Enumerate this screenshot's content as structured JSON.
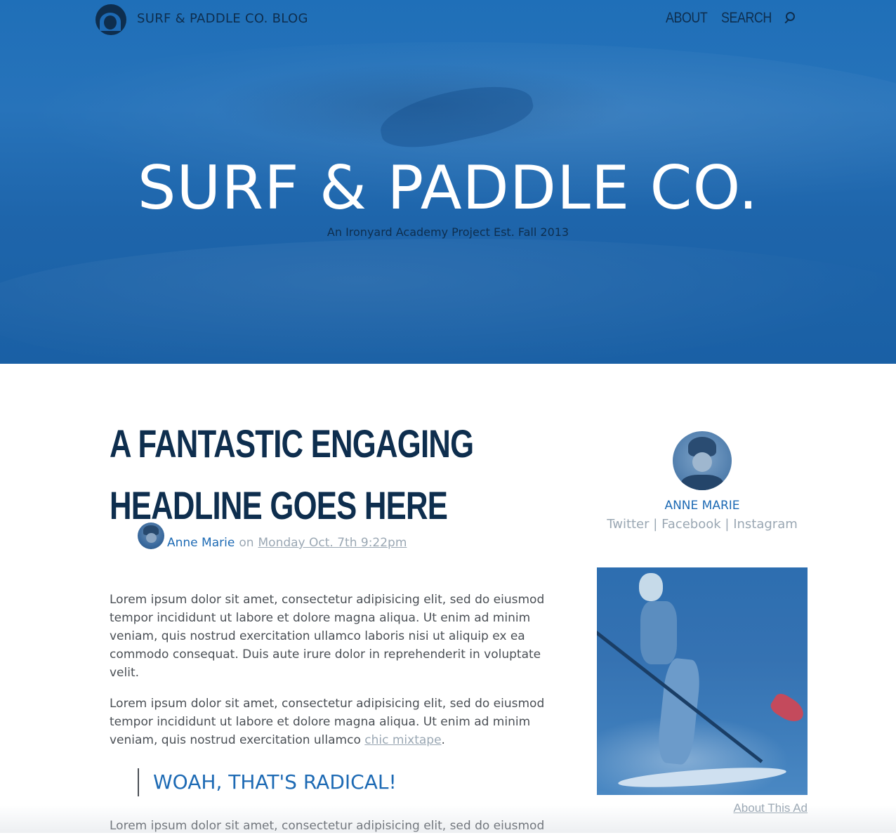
{
  "header": {
    "brand": "SURF & PADDLE CO. BLOG",
    "nav": {
      "about": "ABOUT",
      "search": "SEARCH"
    }
  },
  "hero": {
    "title": "SURF & PADDLE CO.",
    "subtitle": "An Ironyard Academy Project Est. Fall 2013"
  },
  "article": {
    "headline_line1": "A FANTASTIC ENGAGING",
    "headline_line2": "HEADLINE GOES HERE",
    "author": "Anne Marie",
    "on": "on",
    "date": "Monday Oct. 7th 9:22pm",
    "paragraph1": "Lorem ipsum dolor sit amet, consectetur adipisicing elit, sed do eiusmod tempor incididunt ut labore et dolore magna aliqua. Ut enim ad minim veniam, quis nostrud exercitation ullamco laboris nisi ut aliquip ex ea commodo consequat. Duis aute irure dolor in reprehenderit in voluptate velit.",
    "paragraph2": "Lorem ipsum dolor sit amet, consectetur adipisicing elit, sed do eiusmod tempor incididunt ut labore et dolore magna aliqua. Ut enim ad minim veniam, quis nostrud exercitation ullamco",
    "paragraph2_link": "chic mixtape",
    "paragraph2_end": ".",
    "quote": "WOAH, THAT'S RADICAL!",
    "paragraph3": "Lorem ipsum dolor sit amet, consectetur adipisicing elit, sed do eiusmod"
  },
  "sidebar": {
    "name": "ANNE MARIE",
    "links": {
      "twitter": "Twitter",
      "facebook": "Facebook",
      "instagram": "Instagram",
      "separator": "|"
    },
    "ad_link": "About This Ad"
  },
  "colors": {
    "brand_dark": "#0e2e4e",
    "accent_blue": "#1d6ab4",
    "muted": "#9aa7b3",
    "hero_blue": "#1f6fb8"
  }
}
